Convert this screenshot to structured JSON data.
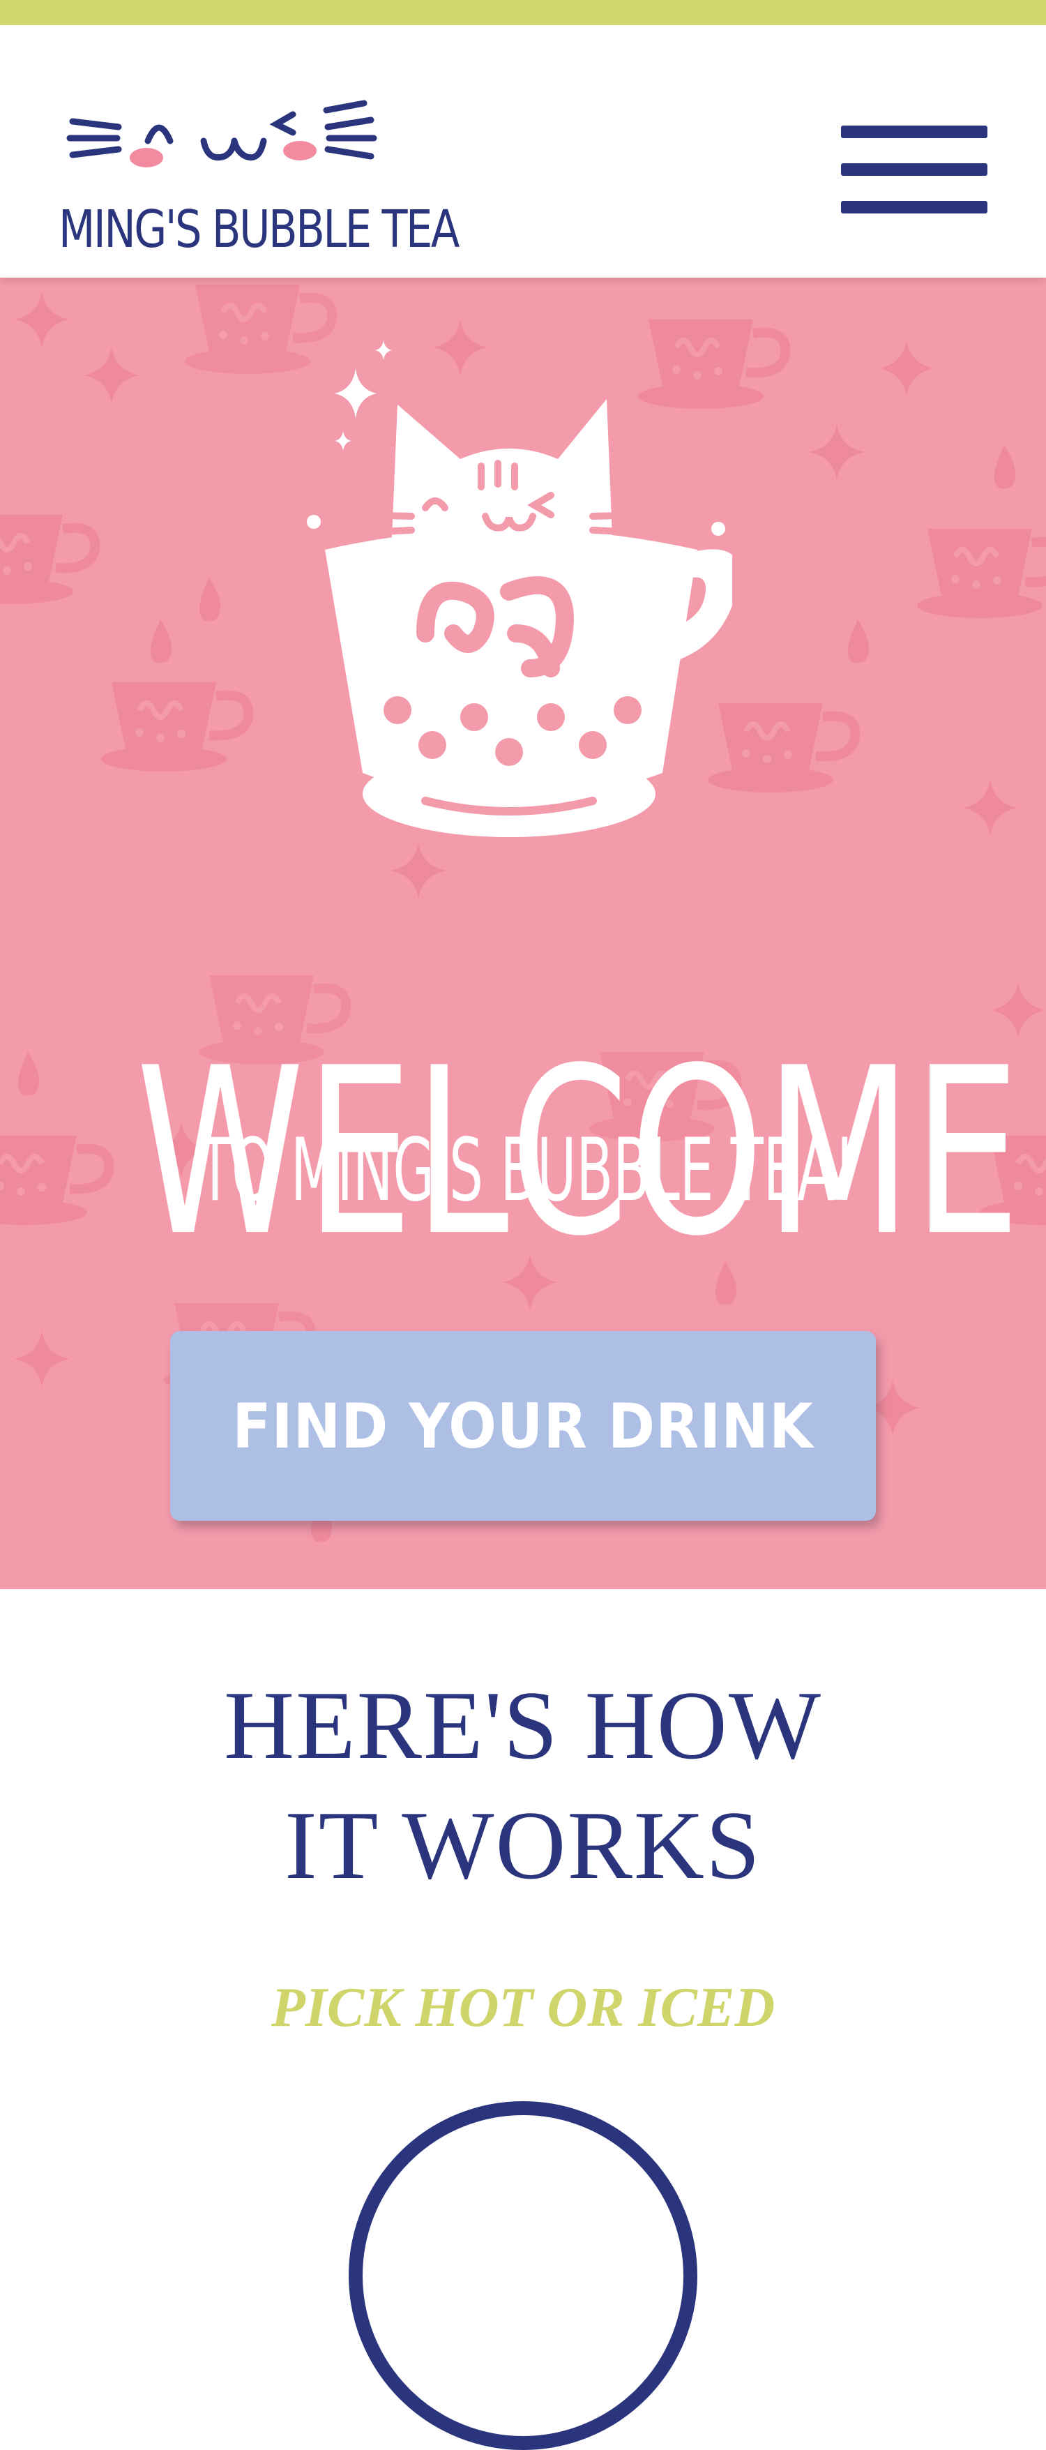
{
  "brand": {
    "name": "MING'S BUBBLE TEA",
    "colors": {
      "navy": "#2a357d",
      "lime": "#d1d66a",
      "pink": "#f49bab",
      "periwinkle": "#adbfe5"
    }
  },
  "header": {
    "logo_icon": "cat-face-icon",
    "menu_icon": "hamburger-menu-icon"
  },
  "hero": {
    "illustration_icon": "cat-in-teacup-icon",
    "title": "WELCOME",
    "subtitle": "TO MING'S BUBBLE TEA!",
    "cta_label": "FIND YOUR DRINK"
  },
  "how_it_works": {
    "title_line1": "HERE'S HOW",
    "title_line2": "IT WORKS",
    "steps": [
      {
        "label": "PICK HOT OR ICED"
      }
    ]
  }
}
